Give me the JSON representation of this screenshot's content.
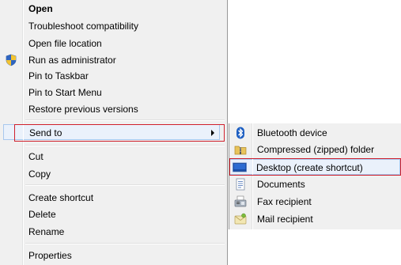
{
  "context_menu": {
    "items": [
      {
        "label": "Open"
      },
      {
        "label": "Troubleshoot compatibility"
      },
      {
        "label": "Open file location"
      },
      {
        "label": "Run as administrator"
      },
      {
        "label": "Pin to Taskbar"
      },
      {
        "label": "Pin to Start Menu"
      },
      {
        "label": "Restore previous versions"
      },
      {
        "label": "Send to"
      },
      {
        "label": "Cut"
      },
      {
        "label": "Copy"
      },
      {
        "label": "Create shortcut"
      },
      {
        "label": "Delete"
      },
      {
        "label": "Rename"
      },
      {
        "label": "Properties"
      }
    ]
  },
  "send_to_menu": {
    "items": [
      {
        "label": "Bluetooth device",
        "icon": "bluetooth-icon"
      },
      {
        "label": "Compressed (zipped) folder",
        "icon": "zip-folder-icon"
      },
      {
        "label": "Desktop (create shortcut)",
        "icon": "desktop-icon"
      },
      {
        "label": "Documents",
        "icon": "documents-icon"
      },
      {
        "label": "Fax recipient",
        "icon": "fax-icon"
      },
      {
        "label": "Mail recipient",
        "icon": "mail-icon"
      }
    ]
  },
  "colors": {
    "menu_background": "#f0f0f0",
    "highlight_fill": "#eaf1fb",
    "highlight_border": "#a8c8ee",
    "annotation_red": "#d0202c"
  }
}
